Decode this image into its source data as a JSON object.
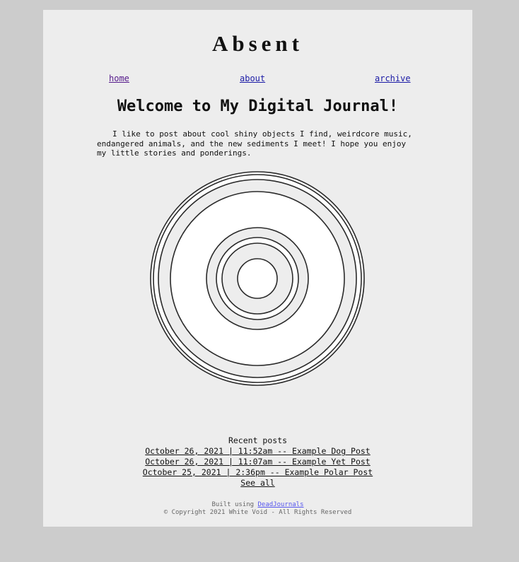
{
  "site": {
    "title": "Absent"
  },
  "nav": {
    "home": "home",
    "about": "about",
    "archive": "archive"
  },
  "main": {
    "heading": "Welcome to My Digital Journal!",
    "intro": "I like to post about cool shiny objects I find, weirdcore music, endangered animals, and the new sediments I meet! I hope you enjoy my little stories and ponderings."
  },
  "recent": {
    "label": "Recent posts",
    "posts": [
      "October 26, 2021 | 11:52am -- Example Dog Post",
      "October 26, 2021 | 11:07am -- Example Yet Post",
      "October 25, 2021 | 2:36pm -- Example Polar Post"
    ],
    "see_all": "See all"
  },
  "footer": {
    "built_prefix": "Built using ",
    "built_link": "DeadJournals",
    "copyright": "© Copyright 2021 White Void - All Rights Reserved"
  }
}
